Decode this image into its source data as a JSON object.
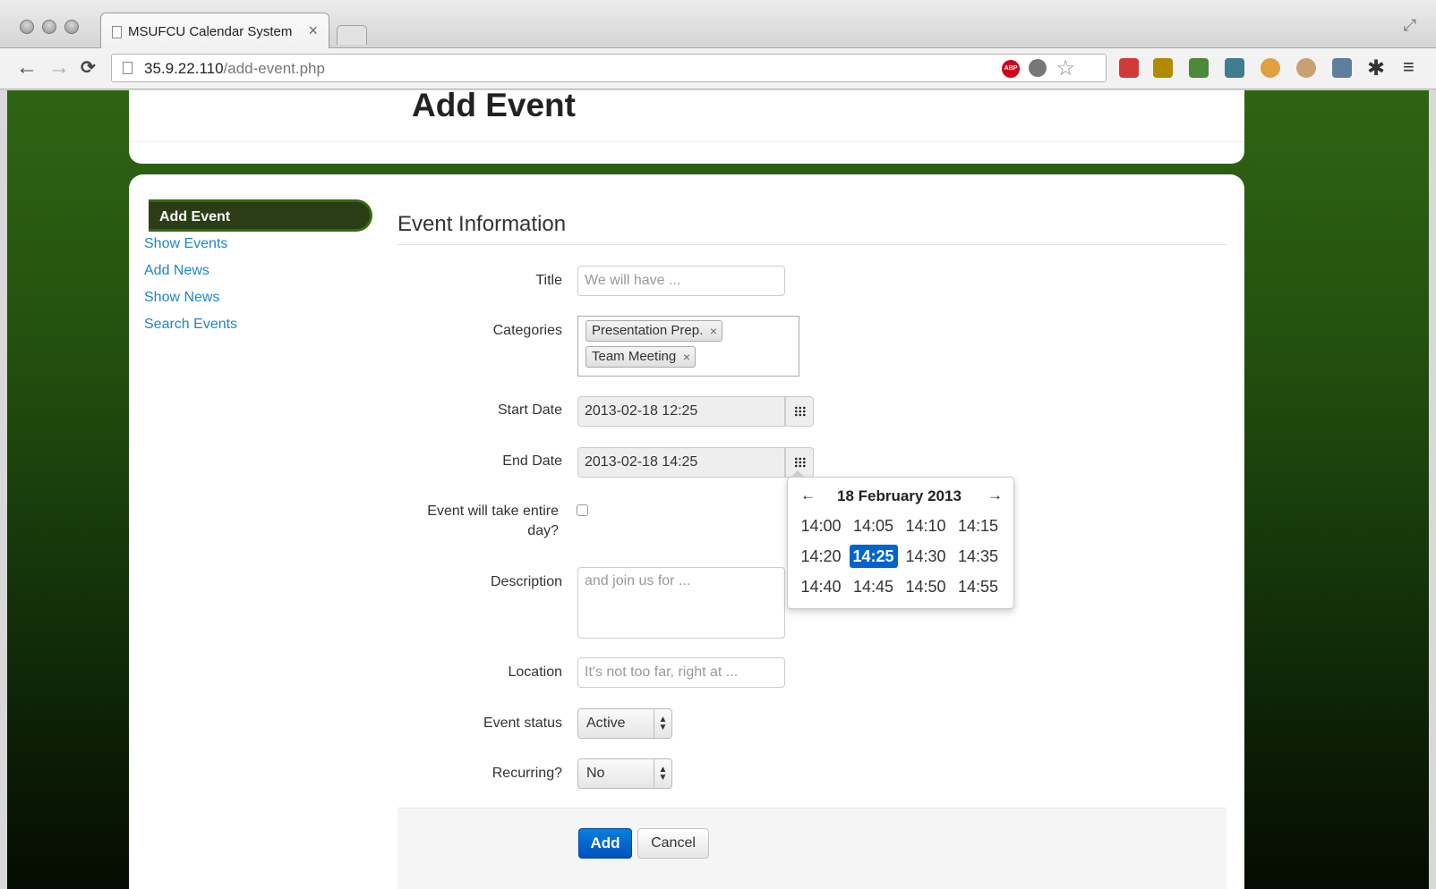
{
  "browser": {
    "tab_title": "MSUFCU Calendar System",
    "tab_close": "×",
    "url_host": "35.9.22.110",
    "url_path": "/add-event.php",
    "nav": {
      "back": "←",
      "forward": "→",
      "reload": "C"
    }
  },
  "page": {
    "title": "Add Event"
  },
  "sidebar": {
    "items": [
      {
        "label": "Add Event",
        "active": true
      },
      {
        "label": "Show Events"
      },
      {
        "label": "Add News"
      },
      {
        "label": "Show News"
      },
      {
        "label": "Search Events"
      }
    ]
  },
  "form": {
    "section_title": "Event Information",
    "title": {
      "label": "Title",
      "placeholder": "We will have ..."
    },
    "categories": {
      "label": "Categories",
      "tags": [
        "Presentation Prep.",
        "Team Meeting"
      ],
      "remove": "×"
    },
    "start_date": {
      "label": "Start Date",
      "value": "2013-02-18 12:25"
    },
    "end_date": {
      "label": "End Date",
      "value": "2013-02-18 14:25"
    },
    "all_day": {
      "label": "Event will take entire day?",
      "checked": false
    },
    "description": {
      "label": "Description",
      "placeholder": "and join us for ..."
    },
    "location": {
      "label": "Location",
      "placeholder": "It's not too far, right at ..."
    },
    "status": {
      "label": "Event status",
      "value": "Active"
    },
    "recurring": {
      "label": "Recurring?",
      "value": "No"
    },
    "add_button": "Add",
    "cancel_button": "Cancel"
  },
  "picker": {
    "header": "18 February 2013",
    "prev": "←",
    "next": "→",
    "times": [
      "14:00",
      "14:05",
      "14:10",
      "14:15",
      "14:20",
      "14:25",
      "14:30",
      "14:35",
      "14:40",
      "14:45",
      "14:50",
      "14:55"
    ],
    "selected": "14:25"
  },
  "colors": {
    "accent": "#0064cc",
    "link": "#1e86c8",
    "nav_active_bg": "#2a3d16",
    "background_green": "#2f6413"
  }
}
